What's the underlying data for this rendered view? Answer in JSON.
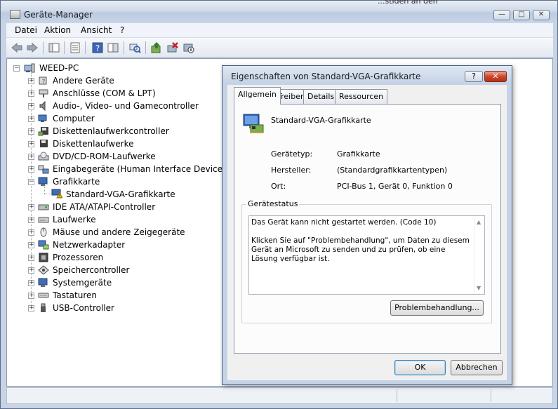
{
  "window": {
    "title": "Geräte-Manager",
    "stray_text": "...stiden an den",
    "min_glyph": "—",
    "max_glyph": "□",
    "close_glyph": "✕"
  },
  "menu": [
    "Datei",
    "Aktion",
    "Ansicht",
    "?"
  ],
  "toolbar": {
    "icons": [
      "back-icon",
      "forward-icon",
      "show-hide-tree-icon",
      "properties-icon",
      "help-icon",
      "view-icon",
      "scan-hardware-icon",
      "update-driver-icon",
      "uninstall-icon",
      "disable-icon"
    ]
  },
  "tree": {
    "root": "WEED-PC",
    "categories": [
      {
        "label": "Andere Geräte",
        "icon": "unknown-device-icon"
      },
      {
        "label": "Anschlüsse (COM & LPT)",
        "icon": "port-icon"
      },
      {
        "label": "Audio-, Video- und Gamecontroller",
        "icon": "speaker-icon"
      },
      {
        "label": "Computer",
        "icon": "computer-icon"
      },
      {
        "label": "Diskettenlaufwerkcontroller",
        "icon": "floppy-controller-icon"
      },
      {
        "label": "Diskettenlaufwerke",
        "icon": "floppy-drive-icon"
      },
      {
        "label": "DVD/CD-ROM-Laufwerke",
        "icon": "cdrom-icon"
      },
      {
        "label": "Eingabegeräte (Human Interface Devices)",
        "icon": "hid-icon"
      },
      {
        "label": "Grafikkarte",
        "icon": "display-adapter-icon",
        "expanded": true
      },
      {
        "label": "Standard-VGA-Grafikkarte",
        "icon": "warning-display-icon",
        "child": true
      },
      {
        "label": "IDE ATA/ATAPI-Controller",
        "icon": "ide-controller-icon"
      },
      {
        "label": "Laufwerke",
        "icon": "disk-drive-icon"
      },
      {
        "label": "Mäuse und andere Zeigegeräte",
        "icon": "mouse-icon"
      },
      {
        "label": "Netzwerkadapter",
        "icon": "network-adapter-icon"
      },
      {
        "label": "Prozessoren",
        "icon": "processor-icon"
      },
      {
        "label": "Speichercontroller",
        "icon": "storage-controller-icon"
      },
      {
        "label": "Systemgeräte",
        "icon": "system-device-icon"
      },
      {
        "label": "Tastaturen",
        "icon": "keyboard-icon"
      },
      {
        "label": "USB-Controller",
        "icon": "usb-icon"
      }
    ]
  },
  "dialog": {
    "title": "Eigenschaften von Standard-VGA-Grafikkarte",
    "help_glyph": "?",
    "close_glyph": "✕",
    "tabs": [
      "Allgemein",
      "Treiber",
      "Details",
      "Ressourcen"
    ],
    "device_name": "Standard-VGA-Grafikkarte",
    "properties": [
      {
        "label": "Gerätetyp:",
        "value": "Grafikkarte"
      },
      {
        "label": "Hersteller:",
        "value": "(Standardgrafikkartentypen)"
      },
      {
        "label": "Ort:",
        "value": "PCI-Bus 1, Gerät 0, Funktion 0"
      }
    ],
    "status_group_title": "Gerätestatus",
    "status_line1": "Das Gerät kann nicht gestartet werden. (Code 10)",
    "status_line2": "Klicken Sie auf \"Problembehandlung\", um Daten zu diesem Gerät an Microsoft zu senden und zu prüfen, ob eine Lösung verfügbar ist.",
    "troubleshoot_label": "Problembehandlung...",
    "ok_label": "OK",
    "cancel_label": "Abbrechen"
  }
}
